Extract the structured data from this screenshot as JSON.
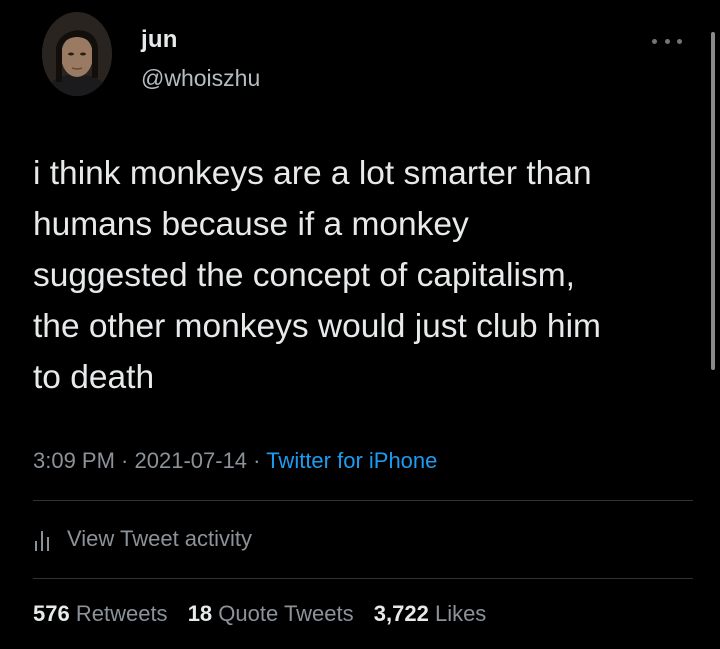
{
  "user": {
    "name": "jun",
    "handle": "@whoiszhu"
  },
  "tweet": {
    "text": "i think monkeys are a lot smarter than\nhumans because if a monkey\nsuggested the concept of capitalism,\nthe other monkeys would just club him\nto death",
    "time": "3:09 PM",
    "date": "2021-07-14",
    "separator": " · ",
    "source": "Twitter for iPhone"
  },
  "activity": {
    "label": "View Tweet activity"
  },
  "stats": {
    "retweets": {
      "count": "576",
      "label": "Retweets"
    },
    "quotes": {
      "count": "18",
      "label": "Quote Tweets"
    },
    "likes": {
      "count": "3,722",
      "label": "Likes"
    }
  },
  "icons": {
    "more": "more-horizontal-icon",
    "activity": "bar-chart-icon"
  },
  "colors": {
    "background": "#000000",
    "text": "#e7e9ea",
    "muted": "#8b9298",
    "link": "#1d9bf0",
    "divider": "#2f3336"
  }
}
